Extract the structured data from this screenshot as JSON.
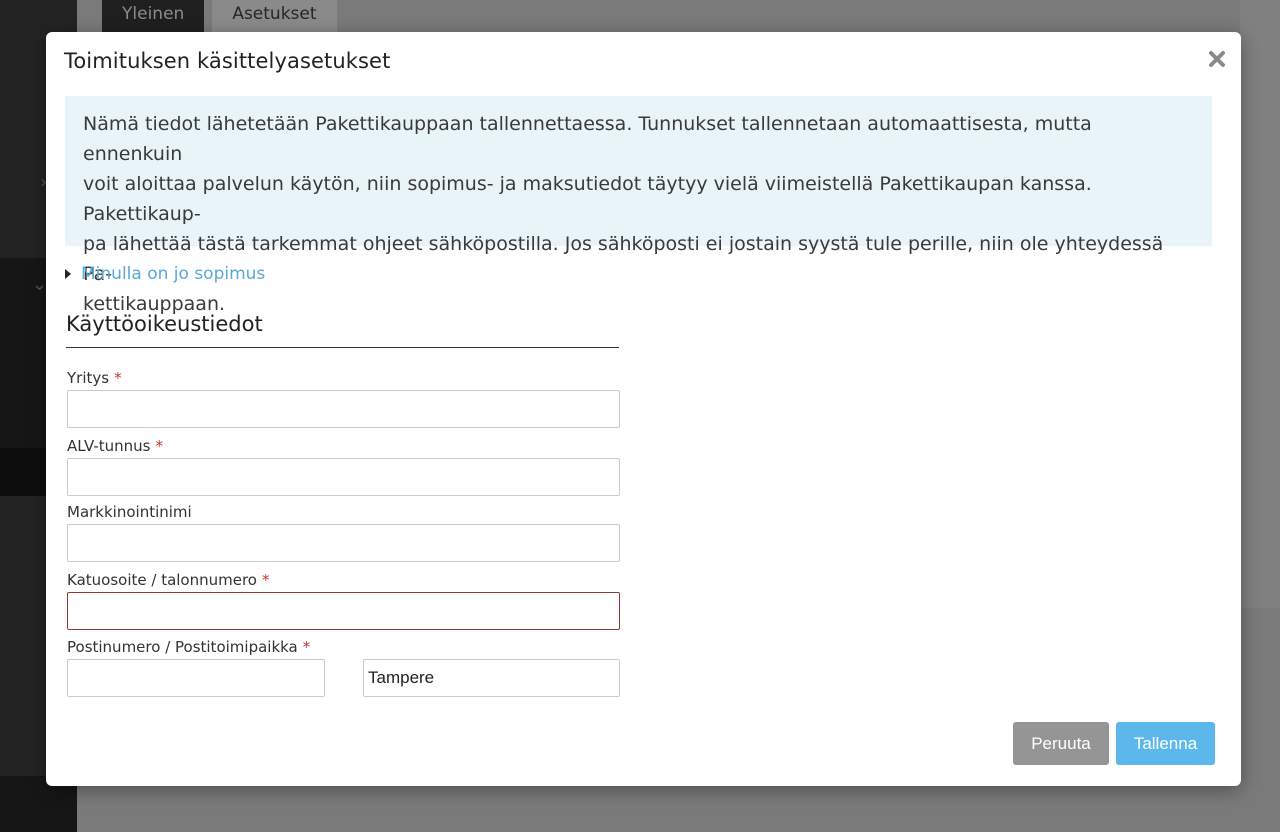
{
  "background": {
    "tabs": [
      {
        "label": "Yleinen"
      },
      {
        "label": "Asetukset"
      }
    ]
  },
  "modal": {
    "title": "Toimituksen käsittelyasetukset",
    "info_lines": [
      "Nämä tiedot lähetetään Pakettikauppaan tallennettaessa. Tunnukset tallennetaan automaattisesta, mutta ennenkuin",
      "voit aloittaa palvelun käytön, niin sopimus- ja maksutiedot täytyy vielä viimeistellä Pakettikaupan kanssa. Pakettikaup-",
      "pa lähettää tästä tarkemmat ohjeet sähköpostilla. Jos sähköposti ei jostain syystä tule perille, niin ole yhteydessä Pa-",
      "kettikauppaan."
    ],
    "agreement_toggle": "Minulla on jo sopimus",
    "section_title": "Käyttöoikeustiedot",
    "fields": {
      "company": {
        "label": "Yritys",
        "required_mark": "*",
        "value": ""
      },
      "vat": {
        "label": "ALV-tunnus",
        "required_mark": "*",
        "value": ""
      },
      "marketing_name": {
        "label": "Markkinointinimi",
        "value": ""
      },
      "street": {
        "label": "Katuosoite / talonnumero",
        "required_mark": "*",
        "value": ""
      },
      "postal": {
        "label": "Postinumero / Postitoimipaikka",
        "required_mark": "*",
        "postcode_value": "",
        "city_value": "Tampere"
      }
    },
    "buttons": {
      "cancel": "Peruuta",
      "save": "Tallenna"
    }
  },
  "colors": {
    "accent": "#5cb8ec",
    "link": "#5aa9d6",
    "required": "#c0392b",
    "info_bg": "#e8f4f8",
    "cancel_bg": "#959595"
  }
}
